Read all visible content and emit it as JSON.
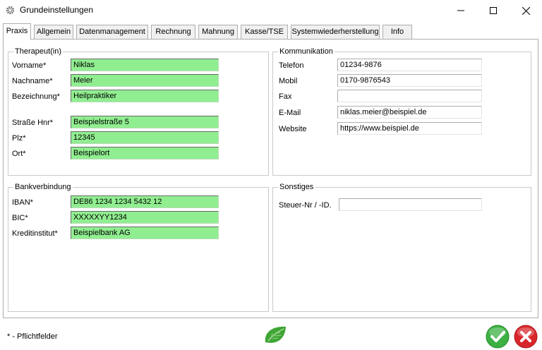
{
  "window": {
    "title": "Grundeinstellungen",
    "icons": {
      "app": "gear-icon",
      "minimize": "minimize-icon",
      "maximize": "maximize-icon",
      "close": "close-icon"
    }
  },
  "tabs": [
    {
      "label": "Praxis",
      "active": true
    },
    {
      "label": "Allgemein"
    },
    {
      "label": "Datenmanagement"
    },
    {
      "label": "Rechnung"
    },
    {
      "label": "Mahnung"
    },
    {
      "label": "Kasse/TSE"
    },
    {
      "label": "Systemwiederherstellung"
    },
    {
      "label": "Info"
    }
  ],
  "therapeut": {
    "legend": "Therapeut(in)",
    "vorname": {
      "label": "Vorname*",
      "value": "Niklas"
    },
    "nachname": {
      "label": "Nachname*",
      "value": "Meier"
    },
    "bezeichnung": {
      "label": "Bezeichnung*",
      "value": "Heilpraktiker"
    },
    "strasse": {
      "label": "Straße Hnr*",
      "value": "Beispielstraße 5"
    },
    "plz": {
      "label": "Plz*",
      "value": "12345"
    },
    "ort": {
      "label": "Ort*",
      "value": "Beispielort"
    }
  },
  "kommunikation": {
    "legend": "Kommunikation",
    "telefon": {
      "label": "Telefon",
      "value": "01234-9876"
    },
    "mobil": {
      "label": "Mobil",
      "value": "0170-9876543"
    },
    "fax": {
      "label": "Fax",
      "value": ""
    },
    "email": {
      "label": "E-Mail",
      "value": "niklas.meier@beispiel.de"
    },
    "website": {
      "label": "Website",
      "value": "https://www.beispiel.de"
    }
  },
  "bank": {
    "legend": "Bankverbindung",
    "iban": {
      "label": "IBAN*",
      "value": "DE86 1234 1234 5432 12"
    },
    "bic": {
      "label": "BIC*",
      "value": "XXXXXYY1234"
    },
    "institut": {
      "label": "Kreditinstitut*",
      "value": "Beispielbank AG"
    }
  },
  "sonstiges": {
    "legend": "Sonstiges",
    "steuer": {
      "label": "Steuer-Nr / -ID.",
      "value": ""
    }
  },
  "footer": {
    "note": "* - Pflichtfelder",
    "icons": {
      "logo": "leaf-icon",
      "ok": "checkmark-icon",
      "cancel": "x-icon"
    }
  },
  "colors": {
    "required_field": "#90ee90",
    "ok": "#3cb043",
    "cancel": "#d9262b"
  }
}
